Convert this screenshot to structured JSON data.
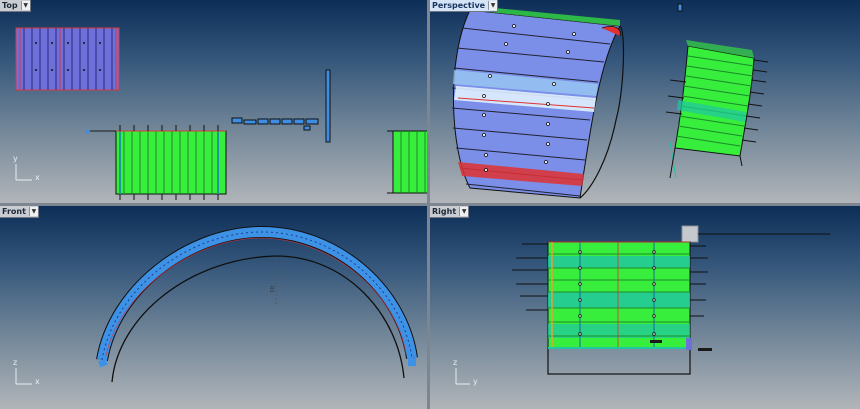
{
  "viewports": {
    "top": {
      "label": "Top",
      "menu_icon": "chevron-down-icon",
      "axis_x": "x",
      "axis_y": "y"
    },
    "perspective": {
      "label": "Perspective",
      "menu_icon": "chevron-down-icon"
    },
    "front": {
      "label": "Front",
      "menu_icon": "chevron-down-icon",
      "axis_x": "x",
      "axis_y": "z"
    },
    "right": {
      "label": "Right",
      "menu_icon": "chevron-down-icon",
      "axis_x": "y",
      "axis_y": "z"
    }
  },
  "colors": {
    "panel_green": "#37ee3c",
    "panel_blue": "#5577e6",
    "arch_blue": "#3d92e6",
    "teal": "#21c6a3",
    "red": "#e03131",
    "highlight": "#1e96ff"
  }
}
